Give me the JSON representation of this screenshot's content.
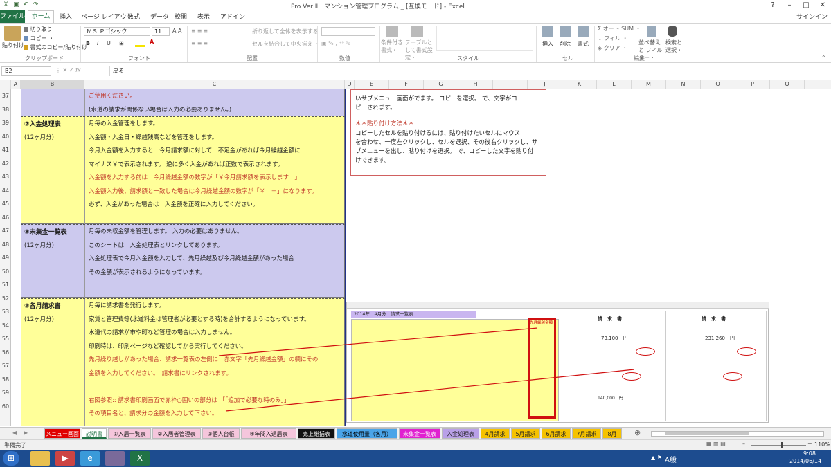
{
  "window": {
    "title": "Pro  Ver Ⅱ　マンション管理プログラム._ [互換モード] - Excel",
    "signin": "サインイン"
  },
  "tabs": {
    "file": "ファイル",
    "home": "ホーム",
    "insert": "挿入",
    "layout": "ページ レイアウト",
    "formulas": "数式",
    "data": "データ",
    "review": "校閲",
    "view": "表示",
    "addin": "アドイン"
  },
  "ribbon": {
    "paste": "貼り付け",
    "cut": "切り取り",
    "copy": "コピー ・",
    "painter": "書式のコピー/貼り付け",
    "clipboard": "クリップボード",
    "font_name": "ＭＳ Ｐゴシック",
    "font_size": "11",
    "font_grp": "フォント",
    "wrap": "折り返して全体を表示する",
    "merge": "セルを結合して中央揃え ・",
    "align_grp": "配置",
    "num_grp": "数値",
    "cond": "条件付き書式・",
    "table": "テーブルとして書式設定・",
    "style_grp": "スタイル",
    "insert": "挿入",
    "delete": "削除",
    "format": "書式",
    "cell_grp": "セル",
    "autosum": "オート SUM ・",
    "fill": "フィル ・",
    "clear": "クリア ・",
    "sort": "並べ替えと フィルター・",
    "find": "検索と 選択・",
    "edit_grp": "編集"
  },
  "formula_bar": {
    "name_box": "B2",
    "formula": "戻る"
  },
  "columns": [
    "A",
    "B",
    "C",
    "D",
    "E",
    "F",
    "G",
    "H",
    "I",
    "J",
    "K",
    "L",
    "M",
    "N",
    "O",
    "P",
    "Q"
  ],
  "rows": [
    "37",
    "38",
    "39",
    "40",
    "41",
    "42",
    "43",
    "44",
    "45",
    "46",
    "47",
    "48",
    "49",
    "50",
    "51",
    "52",
    "53",
    "54",
    "55",
    "56",
    "57",
    "58",
    "59",
    "60"
  ],
  "sections": {
    "top_lines": [
      "ご使用ください。",
      "(水道の請求が関係ない場合は入力の必要ありません。)"
    ],
    "s7": {
      "head": "⑦入金処理表",
      "sub": "(12ヶ月分)",
      "lines": [
        "月毎の入金管理をします。",
        "入金額・入金日・繰越残高などを管理をします。",
        "今月入金額を入力すると　今月請求額に対して　不足金があれば今月繰越金額に",
        "マイナス￥で表示されます。 逆に多く入金があれば正数で表示されます。",
        "入金額を入力する前は　今月繰越金額の数字が「￥今月請求額を表示します　」",
        "入金額入力後、請求額と一致した場合は今月繰越金額の数字が「￥　－」になります。",
        "必ず、入金があった場合は　入金額を正確に入力してください。"
      ]
    },
    "s8": {
      "head": "⑧未集金一覧表",
      "sub": "(12ヶ月分)",
      "lines": [
        "月毎の未収金額を管理します。 入力の必要はありません。",
        "このシートは　入金処理表とリンクしてあります。",
        "入金処理表で今月入金額を入力して、先月繰越及び今月繰越金額があった場合",
        "その金額が表示されるようになっています。"
      ]
    },
    "s9": {
      "head": "⑨各月請求書",
      "sub": "(12ヶ月分)",
      "lines": [
        "月毎に請求書を発行します。",
        "家賃と管理費等(水道料金は管理者が必要とする時)を合計するようになっています。",
        "水道代の請求が市や町など管理の場合は入力しません。",
        "印刷時は、印刷ページなど確認してから実行してください。",
        "先月繰り越しがあった場合、請求一覧表の左側に　赤文字「先月繰越金額」の欄にその",
        "金額を入力してください。　請求書にリンクされます。",
        "",
        "右図参照:: 請求書印刷画面で赤枠○囲いの部分は 「「追加で必要な時のみ」」",
        "その項目名と、請求分の金額を入力して下さい。"
      ]
    }
  },
  "textbox": {
    "lines": [
      "いサブメニュー画面がでます。 コピーを選択。 で、文字がコ",
      "ピーされます。",
      "",
      "＊＊貼り付け方法＊＊",
      "コピーしたセルを貼り付けるには、貼り付けたいセルにマウス",
      "を合わせ、一度左クリックし、セルを選択、その後右クリックし、サ",
      "ブメニューを出し、貼り付けを選択。 で、コピーした文字を貼り付",
      "けできます。"
    ]
  },
  "embedded": {
    "title": "2014年　4月分　請求一覧表",
    "col": "先月繰越金額",
    "invoice": "請　求　書",
    "amount1": "73,100　円",
    "amount2": "231,260　円",
    "sig": "140,000　円"
  },
  "sheet_tabs": [
    "メニュー画面",
    "説明書",
    "①入居一覧表",
    "②入居者管理表",
    "③個人台帳",
    "④年間入退居表",
    "売上総括表",
    "水道使用量（各月）",
    "未集金一覧表",
    "入金処理表",
    "4月請求",
    "5月請求",
    "6月請求",
    "7月請求",
    "8月"
  ],
  "status": {
    "ready": "準備完了",
    "zoom": "110%"
  },
  "taskbar": {
    "time": "9:08",
    "date": "2014/06/14",
    "ime": "A般"
  }
}
